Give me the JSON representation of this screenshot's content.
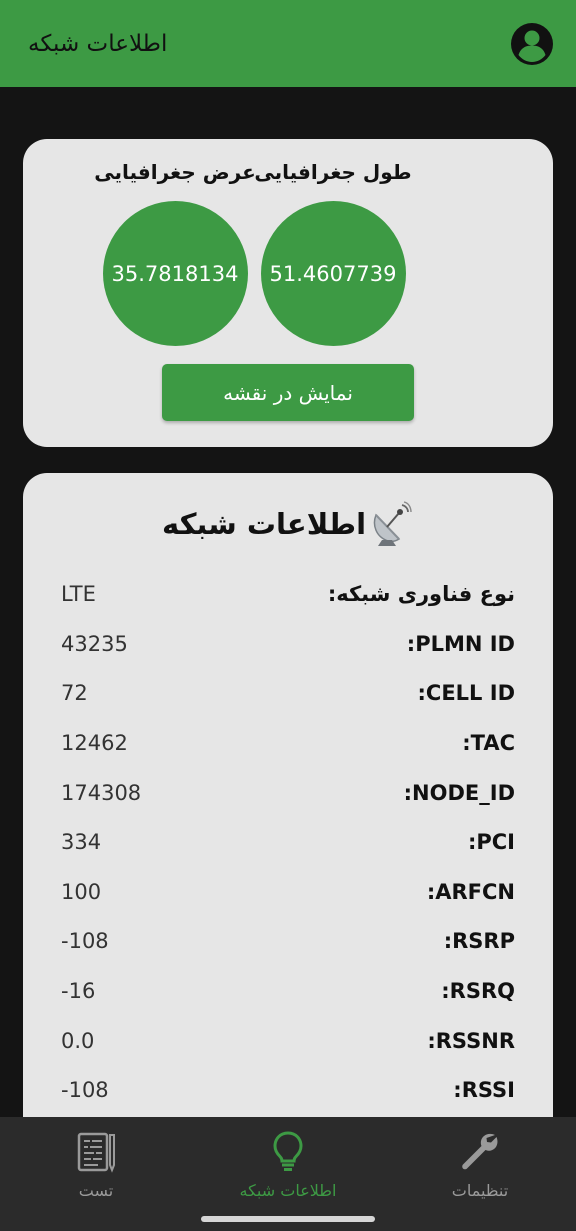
{
  "app_bar": {
    "title": "اطلاعات شبکه",
    "profile_icon": "account-circle-icon"
  },
  "location": {
    "longitude_label": "طول جغرافیایی",
    "longitude_value": "51.4607739",
    "latitude_label": "عرض جغرافیایی",
    "latitude_value": "35.7818134",
    "map_button_label": "نمایش در نقشه"
  },
  "network": {
    "title": "اطلاعات شبکه",
    "icon": "satellite-dish-icon",
    "rows": [
      {
        "key": "نوع فناوری شبکه:",
        "value": "LTE"
      },
      {
        "key": "PLMN ID:",
        "value": "43235"
      },
      {
        "key": "CELL ID:",
        "value": "72"
      },
      {
        "key": "TAC:",
        "value": "12462"
      },
      {
        "key": "NODE_ID:",
        "value": "174308"
      },
      {
        "key": "PCI:",
        "value": "334"
      },
      {
        "key": "ARFCN:",
        "value": "100"
      },
      {
        "key": "RSRP:",
        "value": "-108"
      },
      {
        "key": "RSRQ:",
        "value": "-16"
      },
      {
        "key": "RSSNR:",
        "value": "0.0"
      },
      {
        "key": "RSSI:",
        "value": "-108"
      }
    ]
  },
  "bottom_nav": {
    "items": [
      {
        "label": "تنظیمات",
        "icon": "wrench-icon",
        "active": false
      },
      {
        "label": "اطلاعات شبکه",
        "icon": "lightbulb-icon",
        "active": true
      },
      {
        "label": "تست",
        "icon": "document-edit-icon",
        "active": false
      }
    ]
  },
  "colors": {
    "accent": "#3d9a44",
    "card_bg": "#e6e6e6",
    "page_bg": "#141414",
    "nav_bg": "#2b2b2b"
  }
}
